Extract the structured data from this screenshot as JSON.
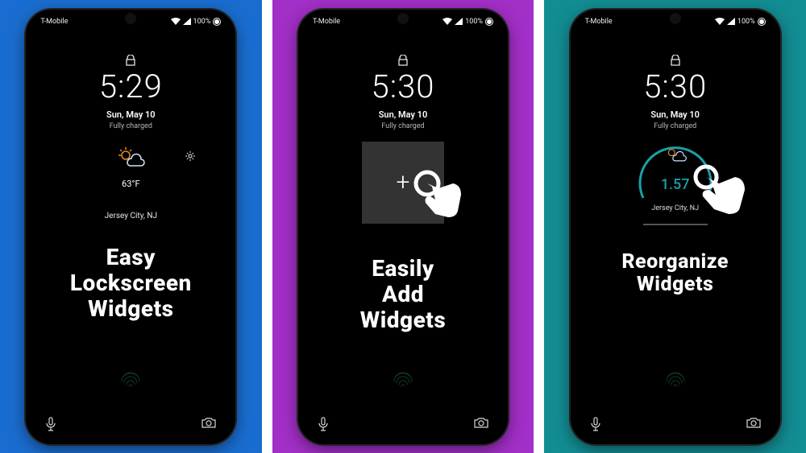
{
  "statusbar": {
    "carrier": "T-Mobile",
    "battery_text": "100%"
  },
  "panels": [
    {
      "bg": "#1a6dd0",
      "time": "5:29",
      "date": "Sun, May 10",
      "charge": "Fully charged",
      "temp": "63°F",
      "location": "Jersey City, NJ",
      "caption": "Easy\nLockscreen\nWidgets"
    },
    {
      "bg": "#a22fc7",
      "time": "5:30",
      "date": "Sun, May 10",
      "charge": "Fully charged",
      "add_label": "+",
      "caption": "Easily\nAdd\nWidgets"
    },
    {
      "bg": "#128d93",
      "time": "5:30",
      "date": "Sun, May 10",
      "charge": "Fully charged",
      "widget_value": "1.57",
      "widget_location": "Jersey City, NJ",
      "caption": "Reorganize\nWidgets"
    }
  ]
}
